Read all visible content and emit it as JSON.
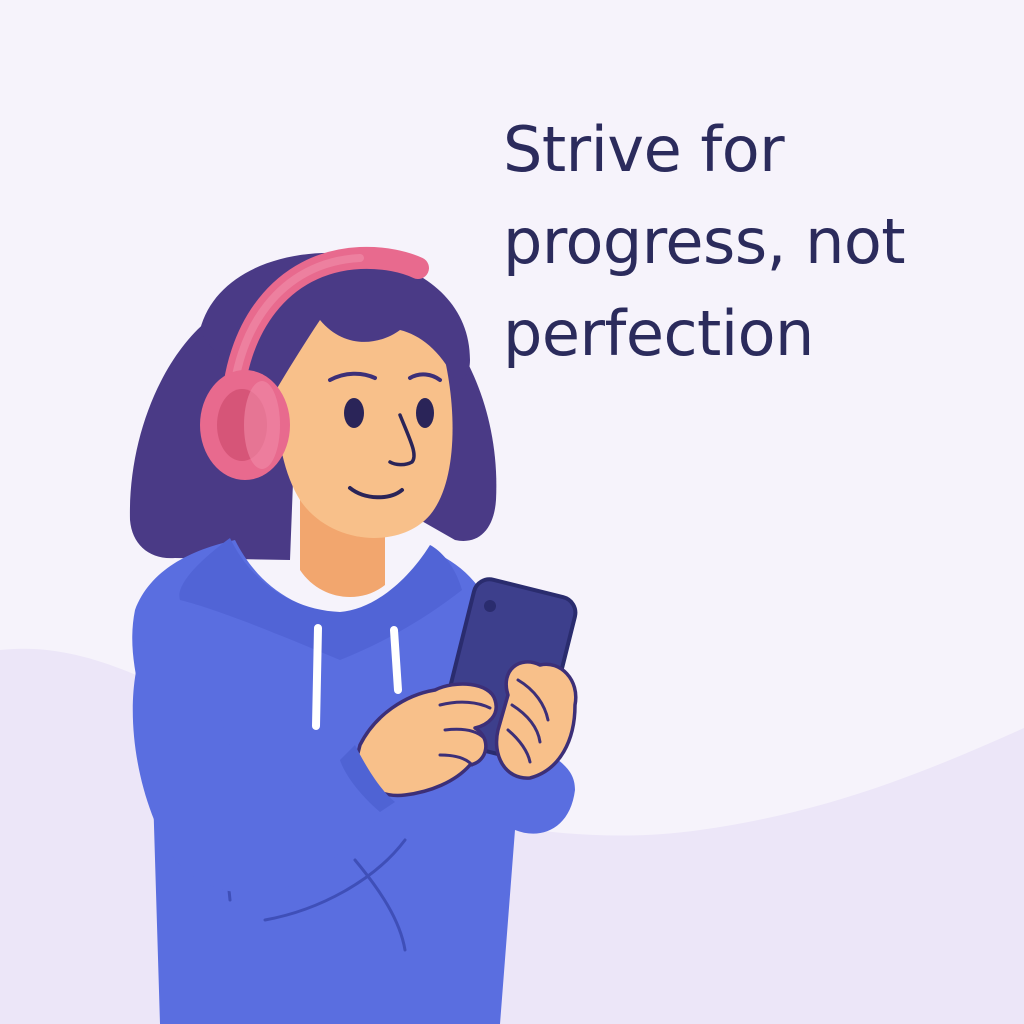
{
  "quote": {
    "lines": [
      "Strive for",
      "progress, not",
      "perfection"
    ]
  },
  "illustration": {
    "subject": "person-with-headphones-holding-phone",
    "icons": [
      "headphones-icon",
      "smartphone-icon"
    ]
  },
  "colors": {
    "background": "#f6f3fb",
    "wave": "#ece6f8",
    "text": "#2b2b5c",
    "hair": "#4a3a86",
    "skin": "#f8c08a",
    "hoodie": "#5a6ee0",
    "headphones": "#e86a8e",
    "phone": "#3d3f8c"
  }
}
